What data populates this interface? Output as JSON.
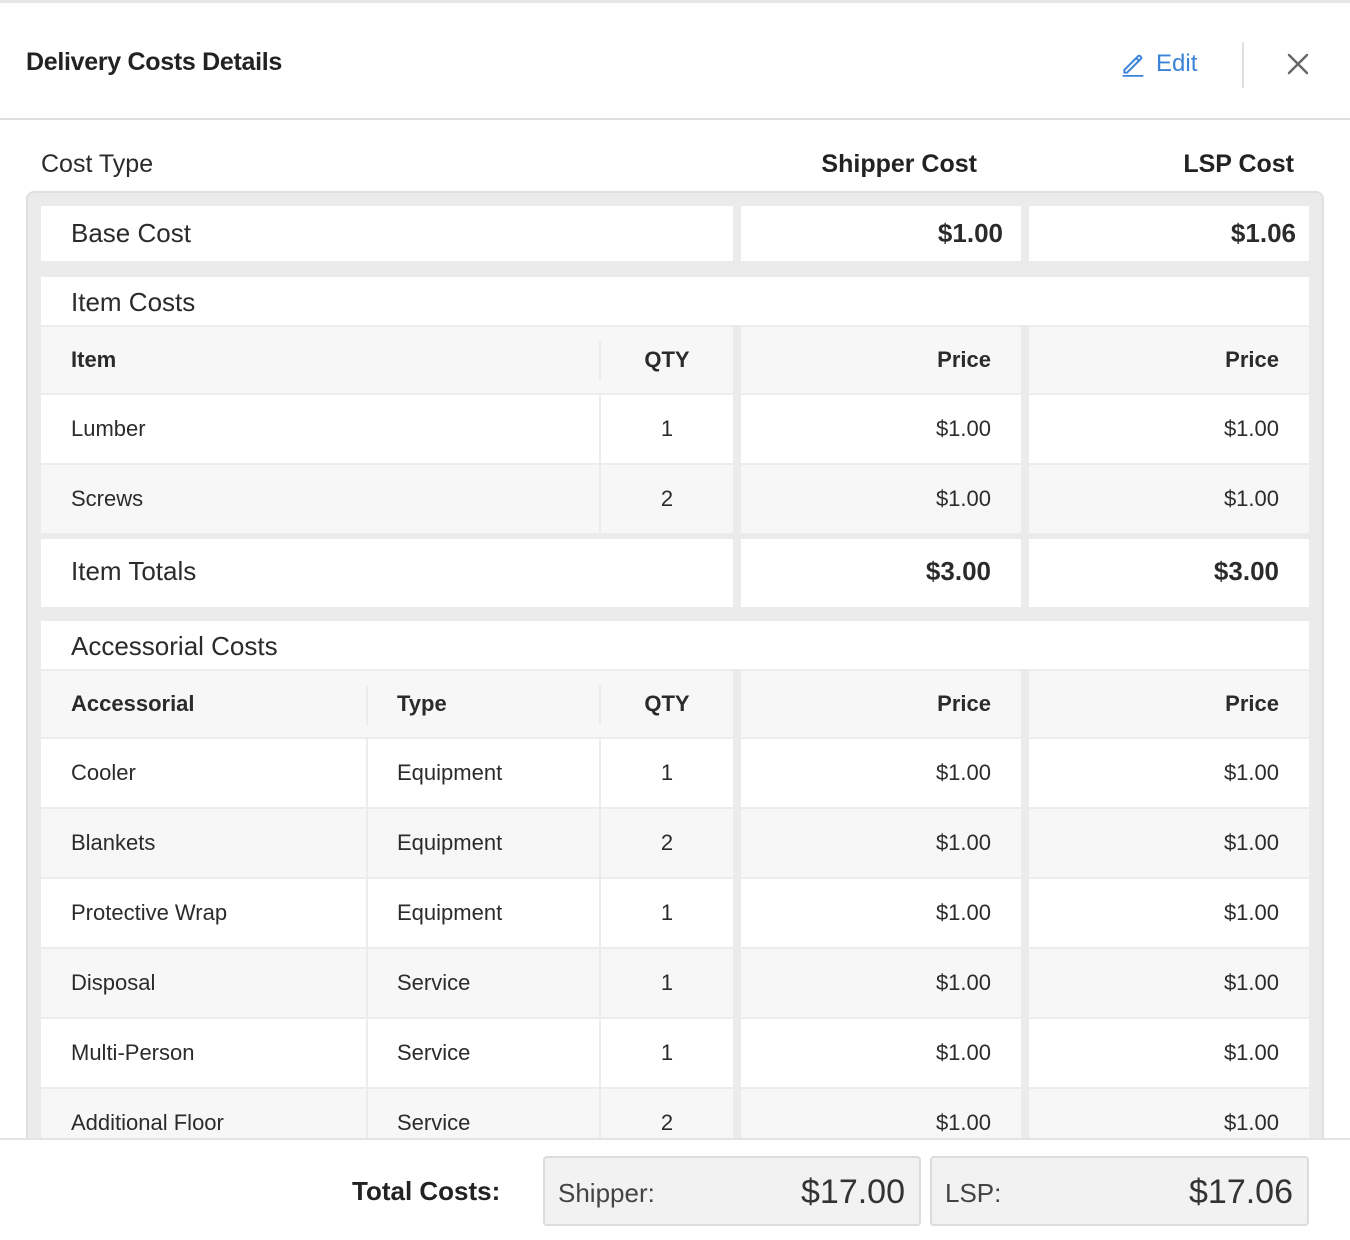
{
  "header": {
    "title": "Delivery Costs Details",
    "edit_label": "Edit",
    "accent_color": "#3a83d9"
  },
  "columns": {
    "cost_type": "Cost Type",
    "shipper_cost": "Shipper Cost",
    "lsp_cost": "LSP Cost"
  },
  "base_cost": {
    "label": "Base Cost",
    "shipper": "$1.00",
    "lsp": "$1.06"
  },
  "item_costs": {
    "title": "Item Costs",
    "headers": {
      "item": "Item",
      "qty": "QTY",
      "shipper_price": "Price",
      "lsp_price": "Price"
    },
    "rows": [
      {
        "item": "Lumber",
        "qty": "1",
        "shipper": "$1.00",
        "lsp": "$1.00"
      },
      {
        "item": "Screws",
        "qty": "2",
        "shipper": "$1.00",
        "lsp": "$1.00"
      }
    ],
    "totals": {
      "label": "Item Totals",
      "shipper": "$3.00",
      "lsp": "$3.00"
    }
  },
  "accessorial_costs": {
    "title": "Accessorial Costs",
    "headers": {
      "accessorial": "Accessorial",
      "type": "Type",
      "qty": "QTY",
      "shipper_price": "Price",
      "lsp_price": "Price"
    },
    "rows": [
      {
        "name": "Cooler",
        "type": "Equipment",
        "qty": "1",
        "shipper": "$1.00",
        "lsp": "$1.00"
      },
      {
        "name": "Blankets",
        "type": "Equipment",
        "qty": "2",
        "shipper": "$1.00",
        "lsp": "$1.00"
      },
      {
        "name": "Protective Wrap",
        "type": "Equipment",
        "qty": "1",
        "shipper": "$1.00",
        "lsp": "$1.00"
      },
      {
        "name": "Disposal",
        "type": "Service",
        "qty": "1",
        "shipper": "$1.00",
        "lsp": "$1.00"
      },
      {
        "name": "Multi-Person",
        "type": "Service",
        "qty": "1",
        "shipper": "$1.00",
        "lsp": "$1.00"
      },
      {
        "name": "Additional Floor",
        "type": "Service",
        "qty": "2",
        "shipper": "$1.00",
        "lsp": "$1.00"
      }
    ]
  },
  "footer": {
    "total_label": "Total Costs:",
    "shipper_label": "Shipper:",
    "shipper_total": "$17.00",
    "lsp_label": "LSP:",
    "lsp_total": "$17.06"
  }
}
